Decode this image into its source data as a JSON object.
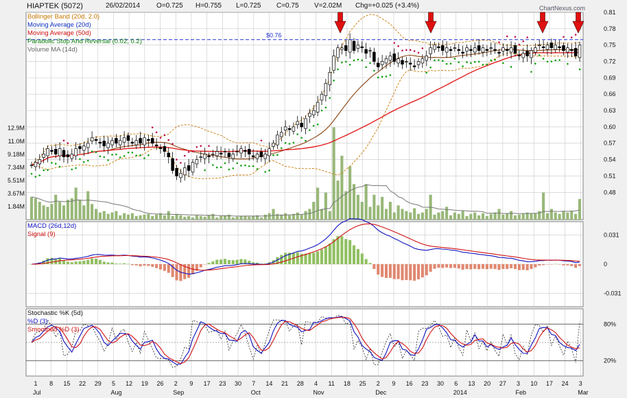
{
  "header": {
    "symbol": "HIAPTEK (5072)",
    "date": "26/02/2014",
    "open": "O=0.725",
    "high": "H=0.755",
    "low": "L=0.725",
    "close": "C=0.75",
    "volume": "V=2.02M",
    "change": "Chg=+0.025 (+3.4%)",
    "watermark": "ChartNexus.com"
  },
  "legends": {
    "price": [
      {
        "label": "Bollinger Band (20d, 2.0)",
        "color": "#c87800"
      },
      {
        "label": "Moving Average (20d)",
        "color": "#1030c0"
      },
      {
        "label": "Moving Average (50d)",
        "color": "#d01010"
      },
      {
        "label": "Parabolic Stop And Reversal (0.02, 0.2)",
        "color": "#108010"
      },
      {
        "label": "Volume MA (14d)",
        "color": "#666666"
      }
    ],
    "macd": [
      {
        "label": "MACD (26d,12d)",
        "color": "#1010c0"
      },
      {
        "label": "Signal (9)",
        "color": "#d01010"
      }
    ],
    "stoch": [
      {
        "label": "Stochastic %K (5d)",
        "color": "#111111"
      },
      {
        "label": "%D (3)",
        "color": "#1010c0"
      },
      {
        "label": "Smoothed %D (3)",
        "color": "#d01010"
      }
    ]
  },
  "annotation": {
    "label": "$0.76",
    "value": 0.76
  },
  "colors": {
    "up": "#ffffff",
    "down": "#000000",
    "vol": "#98b878",
    "bb": "#c87800",
    "ma20": "#8b4513",
    "ma50": "#e01010",
    "sar_up": "#10a010",
    "sar_dn": "#c01050",
    "grid": "#c8c8c8",
    "arrow": "#e01010"
  },
  "chart_data": [
    {
      "type": "candlestick",
      "title": "HIAPTEK (5072)",
      "ylim": [
        0.43,
        0.81
      ],
      "yticks": [
        "0.81",
        "0.78",
        "0.75",
        "0.72",
        "0.69",
        "0.66",
        "0.63",
        "0.60",
        "0.57",
        "0.54",
        "0.51",
        "0.48"
      ],
      "volume_ticks": [
        "12.9M",
        "11.0M",
        "9.18M",
        "7.34M",
        "5.51M",
        "3.67M",
        "1.84M"
      ],
      "volume_ylim_millions": [
        0,
        14.5
      ],
      "x_date_labels": [
        "1",
        "8",
        "15",
        "22",
        "29",
        "5",
        "12",
        "19",
        "26",
        "2",
        "9",
        "17",
        "23",
        "30",
        "7",
        "14",
        "21",
        "28",
        "4",
        "11",
        "18",
        "25",
        "2",
        "9",
        "16",
        "23",
        "30",
        "6",
        "13",
        "20",
        "27",
        "3",
        "10",
        "17",
        "24",
        "3"
      ],
      "x_month_labels": [
        {
          "label": "Jul",
          "at": "1"
        },
        {
          "label": "Aug",
          "at": "5"
        },
        {
          "label": "Sep",
          "at": "2"
        },
        {
          "label": "Oct",
          "at": "7"
        },
        {
          "label": "Nov",
          "at": "4"
        },
        {
          "label": "Dec",
          "at": "2"
        },
        {
          "label": "2014",
          "at": "6"
        },
        {
          "label": "Feb",
          "at": "3"
        },
        {
          "label": "Mar",
          "at": "3"
        }
      ],
      "arrows_at": [
        "11 Nov",
        "16 Dec",
        "10 Feb",
        "24 Feb"
      ],
      "close": [
        0.53,
        0.535,
        0.54,
        0.55,
        0.56,
        0.555,
        0.55,
        0.56,
        0.545,
        0.545,
        0.55,
        0.56,
        0.56,
        0.565,
        0.57,
        0.58,
        0.575,
        0.57,
        0.565,
        0.57,
        0.575,
        0.57,
        0.575,
        0.58,
        0.575,
        0.57,
        0.575,
        0.57,
        0.58,
        0.575,
        0.57,
        0.565,
        0.56,
        0.555,
        0.545,
        0.52,
        0.51,
        0.515,
        0.525,
        0.52,
        0.535,
        0.54,
        0.545,
        0.55,
        0.545,
        0.55,
        0.555,
        0.55,
        0.555,
        0.545,
        0.55,
        0.555,
        0.56,
        0.555,
        0.55,
        0.545,
        0.55,
        0.545,
        0.55,
        0.56,
        0.57,
        0.585,
        0.59,
        0.6,
        0.595,
        0.6,
        0.61,
        0.6,
        0.615,
        0.625,
        0.63,
        0.645,
        0.66,
        0.68,
        0.7,
        0.73,
        0.745,
        0.745,
        0.74,
        0.76,
        0.74,
        0.75,
        0.745,
        0.735,
        0.74,
        0.72,
        0.71,
        0.72,
        0.725,
        0.73,
        0.72,
        0.725,
        0.715,
        0.72,
        0.715,
        0.71,
        0.72,
        0.725,
        0.73,
        0.745,
        0.75,
        0.745,
        0.74,
        0.745,
        0.74,
        0.745,
        0.74,
        0.735,
        0.745,
        0.74,
        0.745,
        0.74,
        0.745,
        0.74,
        0.745,
        0.74,
        0.735,
        0.745,
        0.74,
        0.745,
        0.735,
        0.73,
        0.735,
        0.73,
        0.74,
        0.745,
        0.75,
        0.745,
        0.75,
        0.745,
        0.75,
        0.745,
        0.74,
        0.745,
        0.74,
        0.73,
        0.75
      ],
      "volume_millions": [
        3.2,
        3.0,
        2.5,
        2.0,
        1.8,
        2.2,
        3.5,
        2.5,
        2.0,
        2.8,
        3.0,
        4.5,
        2.8,
        2.0,
        4.0,
        2.2,
        1.5,
        1.0,
        1.2,
        0.8,
        1.0,
        1.2,
        0.6,
        0.9,
        0.7,
        0.9,
        0.5,
        0.6,
        0.7,
        0.8,
        0.5,
        0.7,
        0.9,
        0.6,
        1.2,
        0.5,
        0.8,
        0.6,
        0.4,
        0.5,
        0.3,
        0.6,
        0.5,
        0.4,
        0.6,
        0.8,
        0.3,
        0.5,
        0.6,
        0.7,
        0.3,
        0.4,
        0.5,
        0.5,
        0.4,
        0.5,
        0.6,
        0.3,
        0.7,
        0.9,
        1.5,
        0.8,
        0.7,
        0.9,
        0.6,
        0.8,
        1.0,
        0.7,
        1.2,
        1.5,
        2.5,
        4.5,
        1.5,
        3.8,
        1.2,
        13.0,
        5.5,
        9.0,
        4.0,
        7.5,
        5.0,
        3.5,
        2.5,
        5.0,
        1.8,
        3.5,
        2.0,
        3.2,
        1.5,
        2.5,
        1.0,
        2.0,
        1.5,
        1.2,
        1.0,
        1.6,
        0.8,
        1.0,
        1.5,
        3.5,
        0.7,
        1.0,
        1.2,
        1.8,
        0.6,
        1.0,
        0.8,
        1.2,
        0.5,
        0.8,
        1.0,
        0.6,
        0.9,
        0.5,
        0.8,
        1.0,
        1.5,
        0.7,
        0.9,
        1.2,
        0.6,
        0.7,
        0.8,
        1.0,
        0.9,
        0.9,
        1.2,
        3.8,
        0.9,
        1.5,
        1.0,
        0.8,
        1.2,
        1.0,
        1.2,
        0.8,
        2.9
      ]
    },
    {
      "type": "line",
      "title": "MACD (26d,12d)",
      "ylim": [
        -0.045,
        0.045
      ],
      "yticks": [
        "0.031",
        "0",
        "-0.031"
      ]
    },
    {
      "type": "line",
      "title": "Stochastic %K (5d)",
      "ylim": [
        -5,
        105
      ],
      "yticks": [
        "80%",
        "20%"
      ]
    }
  ]
}
